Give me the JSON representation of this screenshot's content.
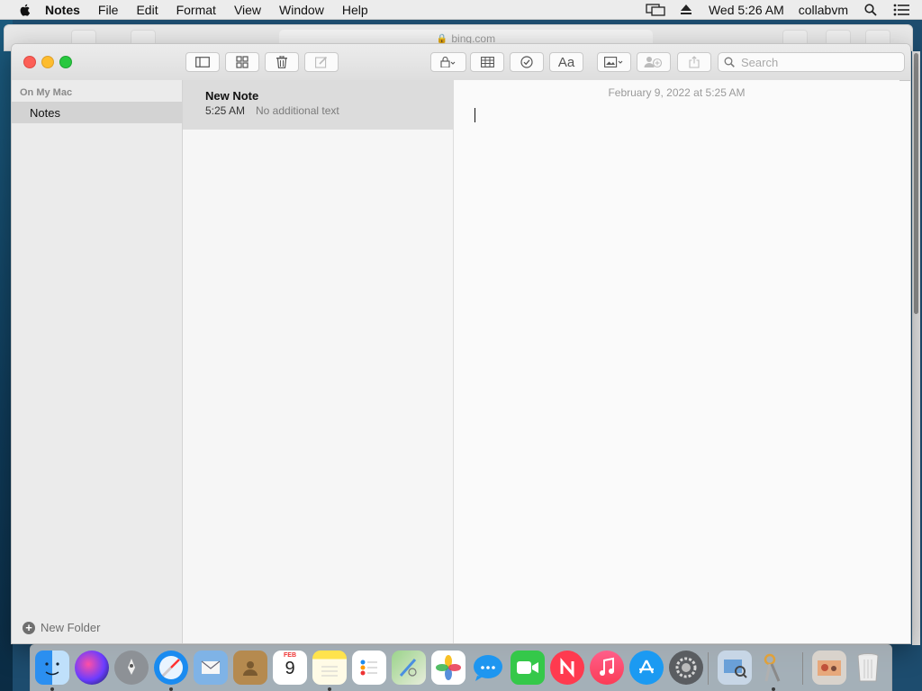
{
  "menubar": {
    "app_name": "Notes",
    "items": [
      "File",
      "Edit",
      "Format",
      "View",
      "Window",
      "Help"
    ],
    "clock": "Wed 5:26 AM",
    "user": "collabvm"
  },
  "safari_bg": {
    "url": "bing.com"
  },
  "toolbar": {
    "search_placeholder": "Search",
    "text_style_label": "Aa"
  },
  "sidebar": {
    "section_title": "On My Mac",
    "folders": [
      {
        "label": "Notes",
        "selected": true
      }
    ],
    "new_folder_label": "New Folder"
  },
  "notes_list": [
    {
      "title": "New Note",
      "time": "5:25 AM",
      "preview": "No additional text",
      "selected": true
    }
  ],
  "editor": {
    "date": "February 9, 2022 at 5:25 AM"
  },
  "dock": {
    "apps": [
      "finder-icon",
      "siri-icon",
      "launchpad-icon",
      "safari-icon",
      "mail-icon",
      "contacts-icon",
      "calendar-icon",
      "notes-icon",
      "reminders-icon",
      "maps-icon",
      "photos-icon",
      "messages-icon",
      "facetime-icon",
      "news-icon",
      "music-icon",
      "app-store-icon",
      "system-preferences-icon",
      "preview-icon",
      "keychain-icon",
      "downloads-stack-icon",
      "trash-icon"
    ],
    "calendar_month": "FEB",
    "calendar_day": "9"
  },
  "colors": {
    "close": "#fc5f57",
    "minimize": "#fdbc2e",
    "zoom": "#28c83f",
    "selection_gray": "#d3d3d3"
  }
}
